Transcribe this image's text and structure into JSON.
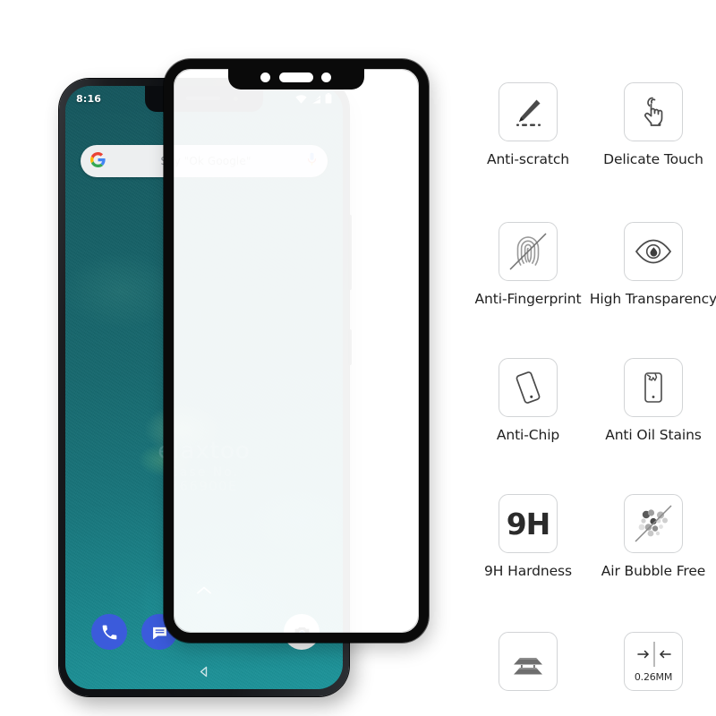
{
  "phone": {
    "status_bar": {
      "time": "8:16",
      "icons": [
        "wifi-icon",
        "signal-icon",
        "battery-icon"
      ]
    },
    "search_bar": {
      "logo": "google-logo",
      "placeholder": "Say \"Ok Google\"",
      "mic_icon": "microphone-icon"
    },
    "watermark": {
      "line1": "elaxtoo",
      "line2": "Case No. 366900E"
    },
    "dock": {
      "items": [
        {
          "name": "phone-app-icon",
          "color": "#3b5bdb"
        },
        {
          "name": "messages-app-icon",
          "color": "#3b5bdb"
        },
        {
          "name": "camera-app-icon",
          "color": "#fafafa"
        }
      ]
    },
    "nav": {
      "app_drawer_icon": "chevron-up-icon",
      "back_icon": "back-triangle-icon"
    },
    "hardware": {
      "notch_cutouts": [
        "front-camera",
        "earpiece-speaker",
        "proximity-sensor"
      ],
      "side_buttons": [
        "power-button",
        "volume-button"
      ]
    }
  },
  "glass_protector": {
    "frame_color": "#0a0a0a",
    "notch_cutouts": [
      "front-camera-cutout",
      "earpiece-cutout",
      "sensor-cutout"
    ]
  },
  "features": [
    [
      {
        "icon": "pen-scratch-icon",
        "label": "Anti-scratch"
      },
      {
        "icon": "tap-hand-icon",
        "label": "Delicate Touch"
      }
    ],
    [
      {
        "icon": "fingerprint-slash-icon",
        "label": "Anti-Fingerprint"
      },
      {
        "icon": "eye-icon",
        "label": "High Transparency"
      }
    ],
    [
      {
        "icon": "tilted-phone-icon",
        "label": "Anti-Chip"
      },
      {
        "icon": "phone-oil-splash-icon",
        "label": "Anti Oil Stains"
      }
    ],
    [
      {
        "icon": "nine-h-text-icon",
        "label": "9H Hardness",
        "text": "9H"
      },
      {
        "icon": "bubbles-slash-icon",
        "label": "Air Bubble Free"
      }
    ],
    [
      {
        "icon": "layered-glass-icon",
        "label": ""
      },
      {
        "icon": "thickness-arrows-icon",
        "label": "",
        "text": "0.26MM"
      }
    ]
  ],
  "colors": {
    "icon_border": "#d2d4d6",
    "icon_stroke": "#4a4a4a",
    "label_text": "#1f1f1f",
    "wallpaper_teal": "#17696f",
    "accent_blue": "#3b5bdb"
  }
}
